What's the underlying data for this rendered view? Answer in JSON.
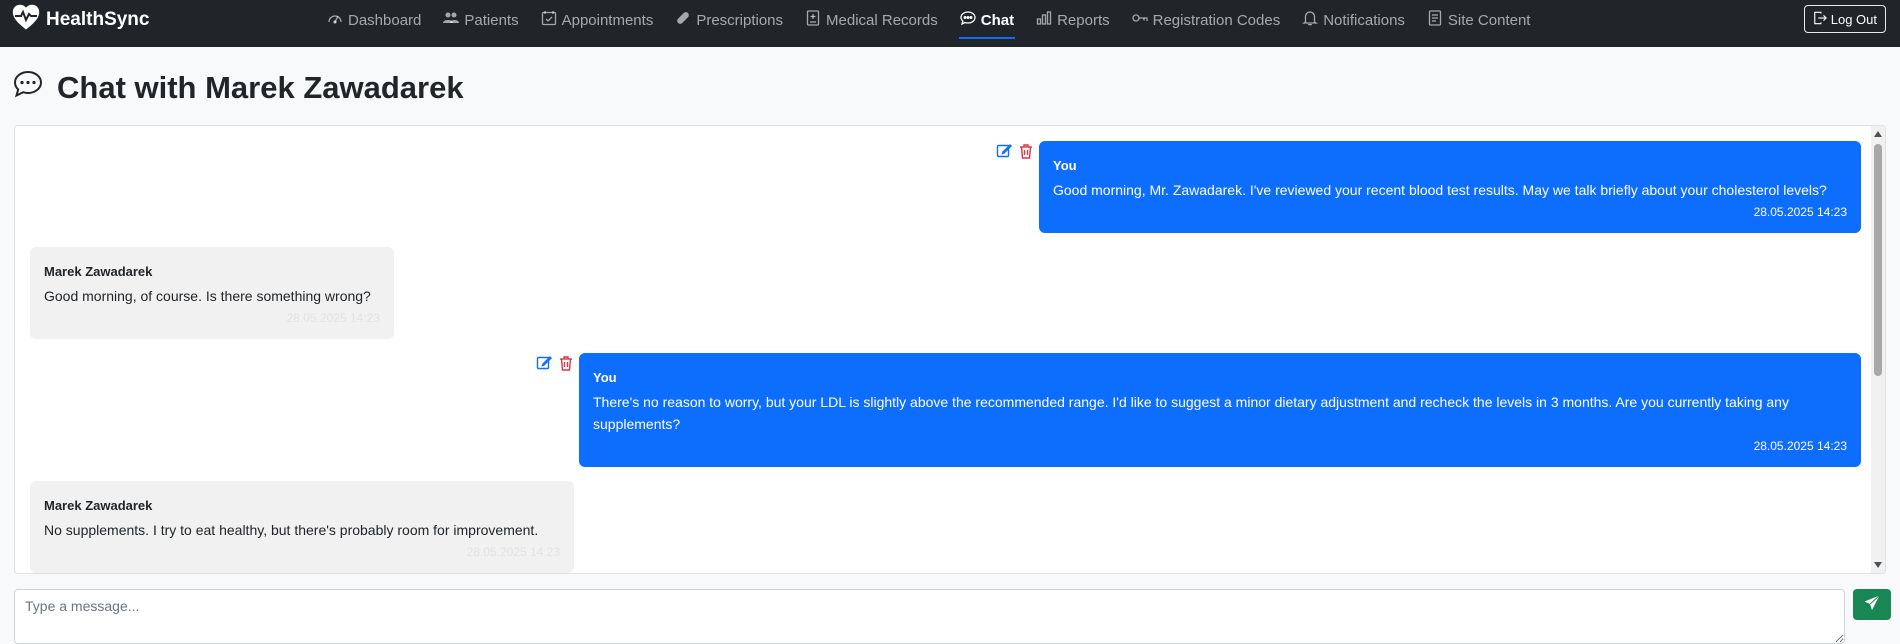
{
  "brand": {
    "name": "HealthSync"
  },
  "nav": {
    "items": [
      {
        "label": "Dashboard",
        "icon": "speedometer-icon",
        "active": false
      },
      {
        "label": "Patients",
        "icon": "people-icon",
        "active": false
      },
      {
        "label": "Appointments",
        "icon": "calendar-check-icon",
        "active": false
      },
      {
        "label": "Prescriptions",
        "icon": "capsule-icon",
        "active": false
      },
      {
        "label": "Medical Records",
        "icon": "file-medical-icon",
        "active": false
      },
      {
        "label": "Chat",
        "icon": "chat-icon",
        "active": true
      },
      {
        "label": "Reports",
        "icon": "bar-chart-icon",
        "active": false
      },
      {
        "label": "Registration Codes",
        "icon": "key-icon",
        "active": false
      },
      {
        "label": "Notifications",
        "icon": "bell-icon",
        "active": false
      },
      {
        "label": "Site Content",
        "icon": "file-text-icon",
        "active": false
      }
    ],
    "logout_label": "Log Out"
  },
  "page": {
    "title": "Chat with Marek Zawadarek"
  },
  "messages": [
    {
      "sender": "You",
      "text": "Good morning, Mr. Zawadarek. I've reviewed your recent blood test results. May we talk briefly about your cholesterol levels?",
      "time": "28.05.2025 14:23",
      "mine": true
    },
    {
      "sender": "Marek Zawadarek",
      "text": "Good morning, of course. Is there something wrong?",
      "time": "28.05.2025 14:23",
      "mine": false
    },
    {
      "sender": "You",
      "text": "There's no reason to worry, but your LDL is slightly above the recommended range. I'd like to suggest a minor dietary adjustment and recheck the levels in 3 months. Are you currently taking any supplements?",
      "time": "28.05.2025 14:23",
      "mine": true
    },
    {
      "sender": "Marek Zawadarek",
      "text": "No supplements. I try to eat healthy, but there's probably room for improvement.",
      "time": "28.05.2025 14:23",
      "mine": false
    }
  ],
  "composer": {
    "placeholder": "Type a message..."
  },
  "colors": {
    "navbar": "#212529",
    "mine_bubble": "#0d6efd",
    "theirs_bubble": "#f1f1f1",
    "send_button": "#198754",
    "delete_icon": "#dc3545",
    "edit_icon": "#0d6efd"
  }
}
